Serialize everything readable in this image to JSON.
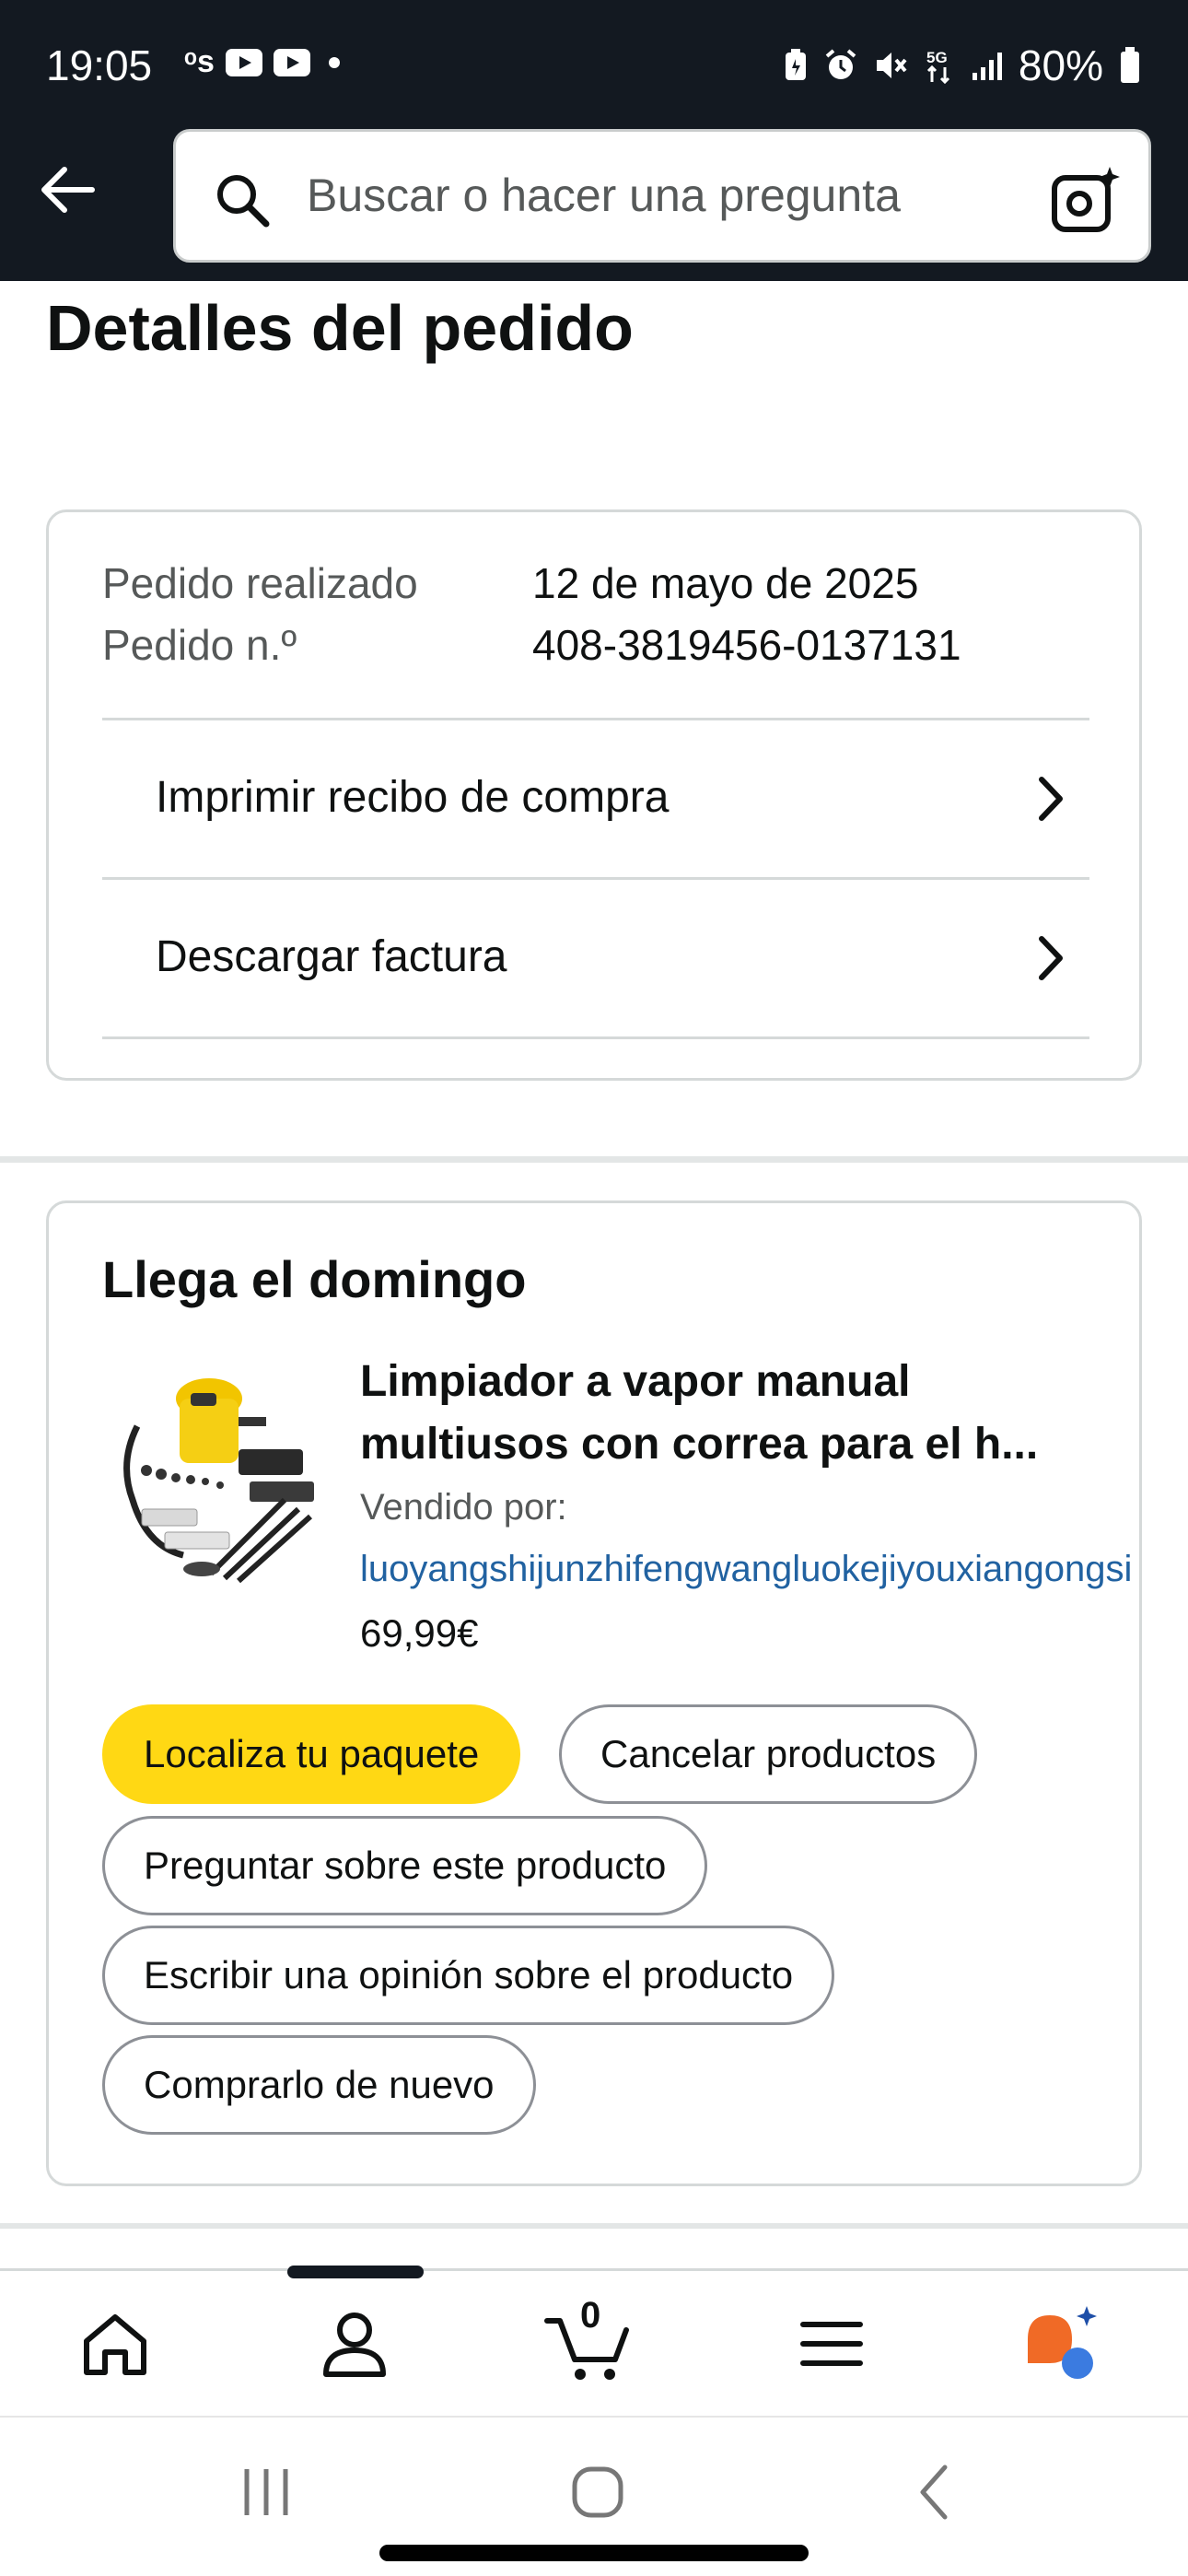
{
  "status_bar": {
    "time": "19:05",
    "left_icons": [
      "os-icon",
      "youtube-icon",
      "youtube-icon",
      "dot-icon"
    ],
    "battery": "80%",
    "right_icons": [
      "battery-saver-icon",
      "alarm-icon",
      "mute-icon",
      "5g-icon",
      "signal-icon",
      "battery-icon"
    ]
  },
  "header": {
    "search_placeholder": "Buscar o hacer una pregunta"
  },
  "page": {
    "title": "Detalles del pedido",
    "order": {
      "placed_label": "Pedido realizado",
      "placed_value": "12 de mayo de 2025",
      "number_label": "Pedido n.º",
      "number_value": "408-3819456-0137131",
      "links": [
        {
          "label": "Imprimir recibo de compra"
        },
        {
          "label": "Descargar factura"
        }
      ]
    },
    "delivery": {
      "title": "Llega el domingo",
      "product_title": "Limpiador a vapor manual multiusos con correa para el h...",
      "sold_by_label": "Vendido por:",
      "seller": "luoyangshijunzhifengwangluokejiyouxiangongsi",
      "price": "69,99€",
      "actions": {
        "track": "Localiza tu paquete",
        "cancel": "Cancelar productos",
        "ask": "Preguntar sobre este producto",
        "review": "Escribir una opinión sobre el producto",
        "buy_again": "Comprarlo de nuevo"
      }
    }
  },
  "bottom_nav": {
    "items": [
      "home-icon",
      "account-icon",
      "cart-icon",
      "menu-icon",
      "rufus-ai-icon"
    ],
    "cart_count": "0",
    "active": "account"
  },
  "colors": {
    "header_bg": "#131921",
    "primary_button": "#ffd814",
    "link": "#2162a1",
    "border": "#d5d9d9"
  }
}
